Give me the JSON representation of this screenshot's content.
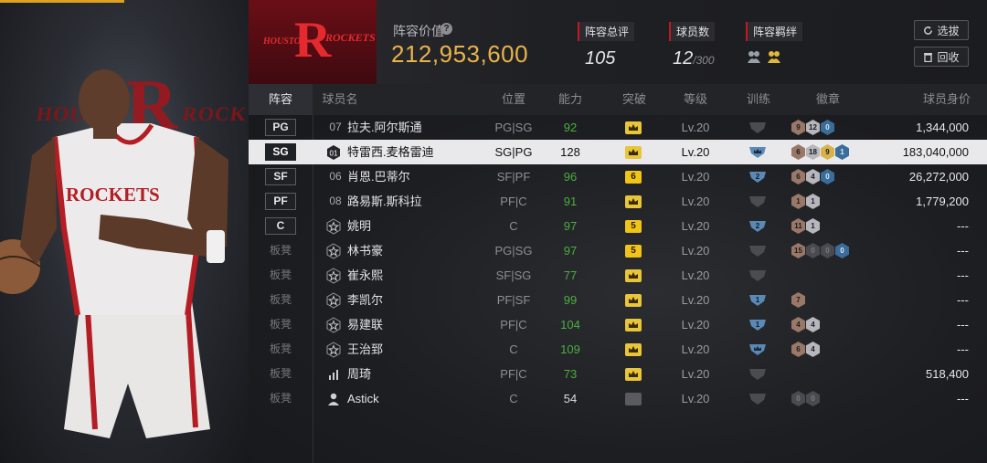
{
  "header": {
    "team_wordmark_left": "HOUSTON",
    "team_wordmark_right": "ROCKETS",
    "lineup_value_label": "阵容价值",
    "lineup_value": "212,953,600",
    "overall_label": "阵容总评",
    "overall_value": "105",
    "player_count_label": "球员数",
    "player_count_value": "12",
    "player_count_max": "/300",
    "bond_label": "阵容羁绊",
    "select_button": "选拔",
    "recycle_button": "回收"
  },
  "player_art": {
    "jersey_text": "ROCKETS",
    "bg_text_left": "HOUS",
    "bg_text_right": "ROCK"
  },
  "columns": [
    "阵容",
    "球员名",
    "位置",
    "能力",
    "突破",
    "等级",
    "训练",
    "徽章",
    "球员身价"
  ],
  "rows": [
    {
      "slot": "PG",
      "num": "07",
      "name": "拉夫.阿尔斯通",
      "pos": "PG|SG",
      "ability": "92",
      "ability_color": "green",
      "breakout": "crown",
      "level": "Lv.20",
      "train": "none",
      "badges": [
        [
          "bronze",
          "9"
        ],
        [
          "silver",
          "12"
        ],
        [
          "blue",
          "0"
        ]
      ],
      "salary": "1,344,000"
    },
    {
      "slot": "SG",
      "num": "01",
      "name": "特雷西.麦格雷迪",
      "pos": "SG|PG",
      "ability": "128",
      "ability_color": "white",
      "breakout": "crown",
      "level": "Lv.20",
      "train": "blue-crown",
      "badges": [
        [
          "bronze",
          "6"
        ],
        [
          "silver",
          "18"
        ],
        [
          "gold",
          "9"
        ],
        [
          "blue",
          "1"
        ]
      ],
      "salary": "183,040,000",
      "selected": true
    },
    {
      "slot": "SF",
      "num": "06",
      "name": "肖恩.巴蒂尔",
      "pos": "SF|PF",
      "ability": "96",
      "ability_color": "green",
      "breakout": "6",
      "level": "Lv.20",
      "train": "2",
      "badges": [
        [
          "bronze",
          "6"
        ],
        [
          "silver",
          "4"
        ],
        [
          "blue",
          "0"
        ]
      ],
      "salary": "26,272,000"
    },
    {
      "slot": "PF",
      "num": "08",
      "name": "路易斯.斯科拉",
      "pos": "PF|C",
      "ability": "91",
      "ability_color": "green",
      "breakout": "crown",
      "level": "Lv.20",
      "train": "none",
      "badges": [
        [
          "bronze",
          "1"
        ],
        [
          "silver",
          "1"
        ]
      ],
      "salary": "1,779,200"
    },
    {
      "slot": "C",
      "num": "star",
      "name": "姚明",
      "pos": "C",
      "ability": "97",
      "ability_color": "green",
      "breakout": "5",
      "level": "Lv.20",
      "train": "2",
      "badges": [
        [
          "bronze",
          "11"
        ],
        [
          "silver",
          "1"
        ]
      ],
      "salary": "---"
    },
    {
      "slot": "板凳",
      "num": "star",
      "name": "林书豪",
      "pos": "PG|SG",
      "ability": "97",
      "ability_color": "green",
      "breakout": "5",
      "level": "Lv.20",
      "train": "none",
      "badges": [
        [
          "bronze",
          "15"
        ],
        [
          "dark",
          "0"
        ],
        [
          "dark",
          "0"
        ],
        [
          "blue",
          "0"
        ]
      ],
      "salary": "---"
    },
    {
      "slot": "板凳",
      "num": "star",
      "name": "崔永熙",
      "pos": "SF|SG",
      "ability": "77",
      "ability_color": "green",
      "breakout": "crown",
      "level": "Lv.20",
      "train": "none",
      "badges": [],
      "salary": "---"
    },
    {
      "slot": "板凳",
      "num": "star",
      "name": "李凯尔",
      "pos": "PF|SF",
      "ability": "99",
      "ability_color": "green",
      "breakout": "crown",
      "level": "Lv.20",
      "train": "1",
      "badges": [
        [
          "bronze",
          "7"
        ]
      ],
      "salary": "---"
    },
    {
      "slot": "板凳",
      "num": "star",
      "name": "易建联",
      "pos": "PF|C",
      "ability": "104",
      "ability_color": "green",
      "breakout": "crown",
      "level": "Lv.20",
      "train": "1",
      "badges": [
        [
          "bronze",
          "4"
        ],
        [
          "silver",
          "4"
        ]
      ],
      "salary": "---"
    },
    {
      "slot": "板凳",
      "num": "star",
      "name": "王治郅",
      "pos": "C",
      "ability": "109",
      "ability_color": "green",
      "breakout": "crown",
      "level": "Lv.20",
      "train": "blue-crown",
      "badges": [
        [
          "bronze",
          "6"
        ],
        [
          "silver",
          "4"
        ]
      ],
      "salary": "---"
    },
    {
      "slot": "板凳",
      "num": "bars",
      "name": "周琦",
      "pos": "PF|C",
      "ability": "73",
      "ability_color": "green",
      "breakout": "crown",
      "level": "Lv.20",
      "train": "none",
      "badges": [],
      "salary": "518,400"
    },
    {
      "slot": "板凳",
      "num": "person",
      "name": "Astick",
      "pos": "C",
      "ability": "54",
      "ability_color": "white",
      "breakout": "none",
      "level": "Lv.20",
      "train": "none",
      "badges": [
        [
          "dark",
          "0"
        ],
        [
          "dark",
          "0"
        ]
      ],
      "salary": "---"
    }
  ],
  "colors": {
    "accent_gold": "#e9b34b",
    "team_red": "#c4181f",
    "ability_green": "#4caf3f",
    "breakout_yellow": "#f0c419",
    "selected_row": "#e9e9ec"
  },
  "icons": {
    "help": "question-circle-icon",
    "select": "refresh-icon",
    "recycle": "recycle-bin-icon",
    "bond": "handshake-icon"
  }
}
